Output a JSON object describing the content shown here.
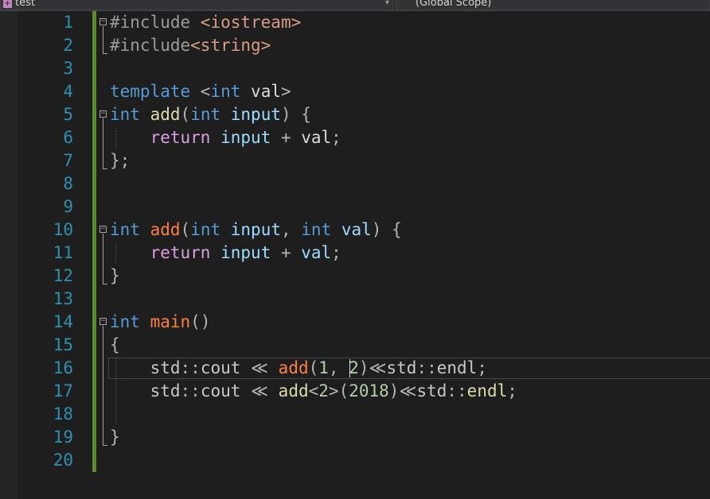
{
  "toolbar": {
    "project_dropdown": "test",
    "scope_dropdown": "(Global Scope)"
  },
  "editor": {
    "lines": [
      {
        "n": "1",
        "tokens": [
          {
            "t": "#include ",
            "c": "pp"
          },
          {
            "t": "<iostream>",
            "c": "str"
          }
        ]
      },
      {
        "n": "2",
        "tokens": [
          {
            "t": "#include",
            "c": "pp"
          },
          {
            "t": "<string>",
            "c": "str"
          }
        ]
      },
      {
        "n": "3",
        "tokens": []
      },
      {
        "n": "4",
        "tokens": [
          {
            "t": "template",
            "c": "kw"
          },
          {
            "t": " <",
            "c": "op"
          },
          {
            "t": "int",
            "c": "kw"
          },
          {
            "t": " ",
            "c": "id"
          },
          {
            "t": "val",
            "c": "id"
          },
          {
            "t": ">",
            "c": "op"
          }
        ]
      },
      {
        "n": "5",
        "tokens": [
          {
            "t": "int",
            "c": "kw"
          },
          {
            "t": " ",
            "c": "id"
          },
          {
            "t": "add",
            "c": "fn"
          },
          {
            "t": "(",
            "c": "op"
          },
          {
            "t": "int",
            "c": "kw"
          },
          {
            "t": " input",
            "c": "pr"
          },
          {
            "t": ") {",
            "c": "op"
          }
        ]
      },
      {
        "n": "6",
        "tokens": [
          {
            "t": "    ",
            "c": "id"
          },
          {
            "t": "return",
            "c": "ctl"
          },
          {
            "t": " input",
            "c": "pr"
          },
          {
            "t": " + ",
            "c": "op"
          },
          {
            "t": "val",
            "c": "id"
          },
          {
            "t": ";",
            "c": "op"
          }
        ]
      },
      {
        "n": "7",
        "tokens": [
          {
            "t": "};",
            "c": "op"
          }
        ]
      },
      {
        "n": "8",
        "tokens": []
      },
      {
        "n": "9",
        "tokens": []
      },
      {
        "n": "10",
        "tokens": [
          {
            "t": "int",
            "c": "kw"
          },
          {
            "t": " ",
            "c": "id"
          },
          {
            "t": "add",
            "c": "fn2"
          },
          {
            "t": "(",
            "c": "op"
          },
          {
            "t": "int",
            "c": "kw"
          },
          {
            "t": " input",
            "c": "pr"
          },
          {
            "t": ", ",
            "c": "op"
          },
          {
            "t": "int",
            "c": "kw"
          },
          {
            "t": " val",
            "c": "pr"
          },
          {
            "t": ") {",
            "c": "op"
          }
        ]
      },
      {
        "n": "11",
        "tokens": [
          {
            "t": "    ",
            "c": "id"
          },
          {
            "t": "return",
            "c": "ctl"
          },
          {
            "t": " input",
            "c": "pr"
          },
          {
            "t": " + ",
            "c": "op"
          },
          {
            "t": "val",
            "c": "pr"
          },
          {
            "t": ";",
            "c": "op"
          }
        ]
      },
      {
        "n": "12",
        "tokens": [
          {
            "t": "}",
            "c": "op"
          }
        ]
      },
      {
        "n": "13",
        "tokens": []
      },
      {
        "n": "14",
        "tokens": [
          {
            "t": "int",
            "c": "kw"
          },
          {
            "t": " ",
            "c": "id"
          },
          {
            "t": "main",
            "c": "fn2"
          },
          {
            "t": "()",
            "c": "op"
          }
        ]
      },
      {
        "n": "15",
        "tokens": [
          {
            "t": "{",
            "c": "op"
          }
        ]
      },
      {
        "n": "16",
        "tokens": [
          {
            "t": "    ",
            "c": "id"
          },
          {
            "t": "std",
            "c": "ns"
          },
          {
            "t": "::",
            "c": "op"
          },
          {
            "t": "cout",
            "c": "ns"
          },
          {
            "t": " ≪ ",
            "c": "op"
          },
          {
            "t": "add",
            "c": "fn2"
          },
          {
            "t": "(",
            "c": "op"
          },
          {
            "t": "1",
            "c": "num"
          },
          {
            "t": ", ",
            "c": "op"
          },
          {
            "t": "2",
            "c": "num"
          },
          {
            "t": ")≪",
            "c": "op"
          },
          {
            "t": "std",
            "c": "ns"
          },
          {
            "t": "::",
            "c": "op"
          },
          {
            "t": "endl",
            "c": "ns"
          },
          {
            "t": ";",
            "c": "op"
          }
        ]
      },
      {
        "n": "17",
        "tokens": [
          {
            "t": "    ",
            "c": "id"
          },
          {
            "t": "std",
            "c": "ns"
          },
          {
            "t": "::",
            "c": "op"
          },
          {
            "t": "cout",
            "c": "ns"
          },
          {
            "t": " ≪ ",
            "c": "op"
          },
          {
            "t": "add",
            "c": "fn"
          },
          {
            "t": "<",
            "c": "op"
          },
          {
            "t": "2",
            "c": "num"
          },
          {
            "t": ">(",
            "c": "op"
          },
          {
            "t": "2018",
            "c": "num"
          },
          {
            "t": ")≪",
            "c": "op"
          },
          {
            "t": "std",
            "c": "ns"
          },
          {
            "t": "::",
            "c": "op"
          },
          {
            "t": "endl",
            "c": "fn"
          },
          {
            "t": ";",
            "c": "op"
          }
        ]
      },
      {
        "n": "18",
        "tokens": []
      },
      {
        "n": "19",
        "tokens": [
          {
            "t": "}",
            "c": "op"
          }
        ]
      },
      {
        "n": "20",
        "tokens": []
      }
    ]
  }
}
